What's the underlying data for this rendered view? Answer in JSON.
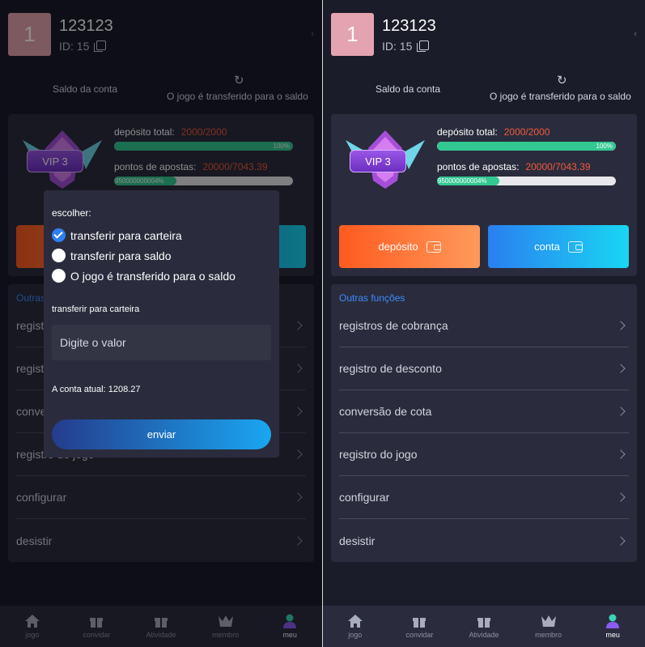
{
  "user": {
    "avatar_text": "1",
    "name": "123123",
    "id_label": "ID: 15"
  },
  "balance": {
    "saldo_label": "Saldo da conta",
    "transfer_label": "O jogo é transferido para o saldo"
  },
  "vip": {
    "level": "VIP 3",
    "deposit": {
      "label": "depósito total:",
      "value": "2000/2000",
      "progress": 1.0,
      "progress_text": "100%"
    },
    "bets": {
      "label": "pontos de apostas:",
      "value": "20000/7043.39",
      "progress": 0.35,
      "progress_text": "950000000004%"
    }
  },
  "actions": {
    "deposit": "depósito",
    "account": "conta"
  },
  "menu": {
    "title": "Outras funções",
    "items": [
      "registros de cobrança",
      "registro de desconto",
      "conversão de cota",
      "registro do jogo",
      "configurar",
      "desistir"
    ]
  },
  "tabs": [
    "jogo",
    "convidar",
    "Atividade",
    "membro",
    "meu"
  ],
  "dialog": {
    "title": "escolher:",
    "options": [
      "transferir para carteira",
      "transferir para saldo",
      "O jogo é transferido para o saldo"
    ],
    "subtitle": "transferir para carteira",
    "input_placeholder": "Digite o valor",
    "current_balance": "A conta atual: 1208.27",
    "submit": "enviar"
  },
  "colors": {
    "accent_blue": "#3d8bff",
    "value_red": "#f25a3b",
    "progress_green": "#33c892",
    "bg": "#1b1c29",
    "card": "#2a2c3d"
  }
}
